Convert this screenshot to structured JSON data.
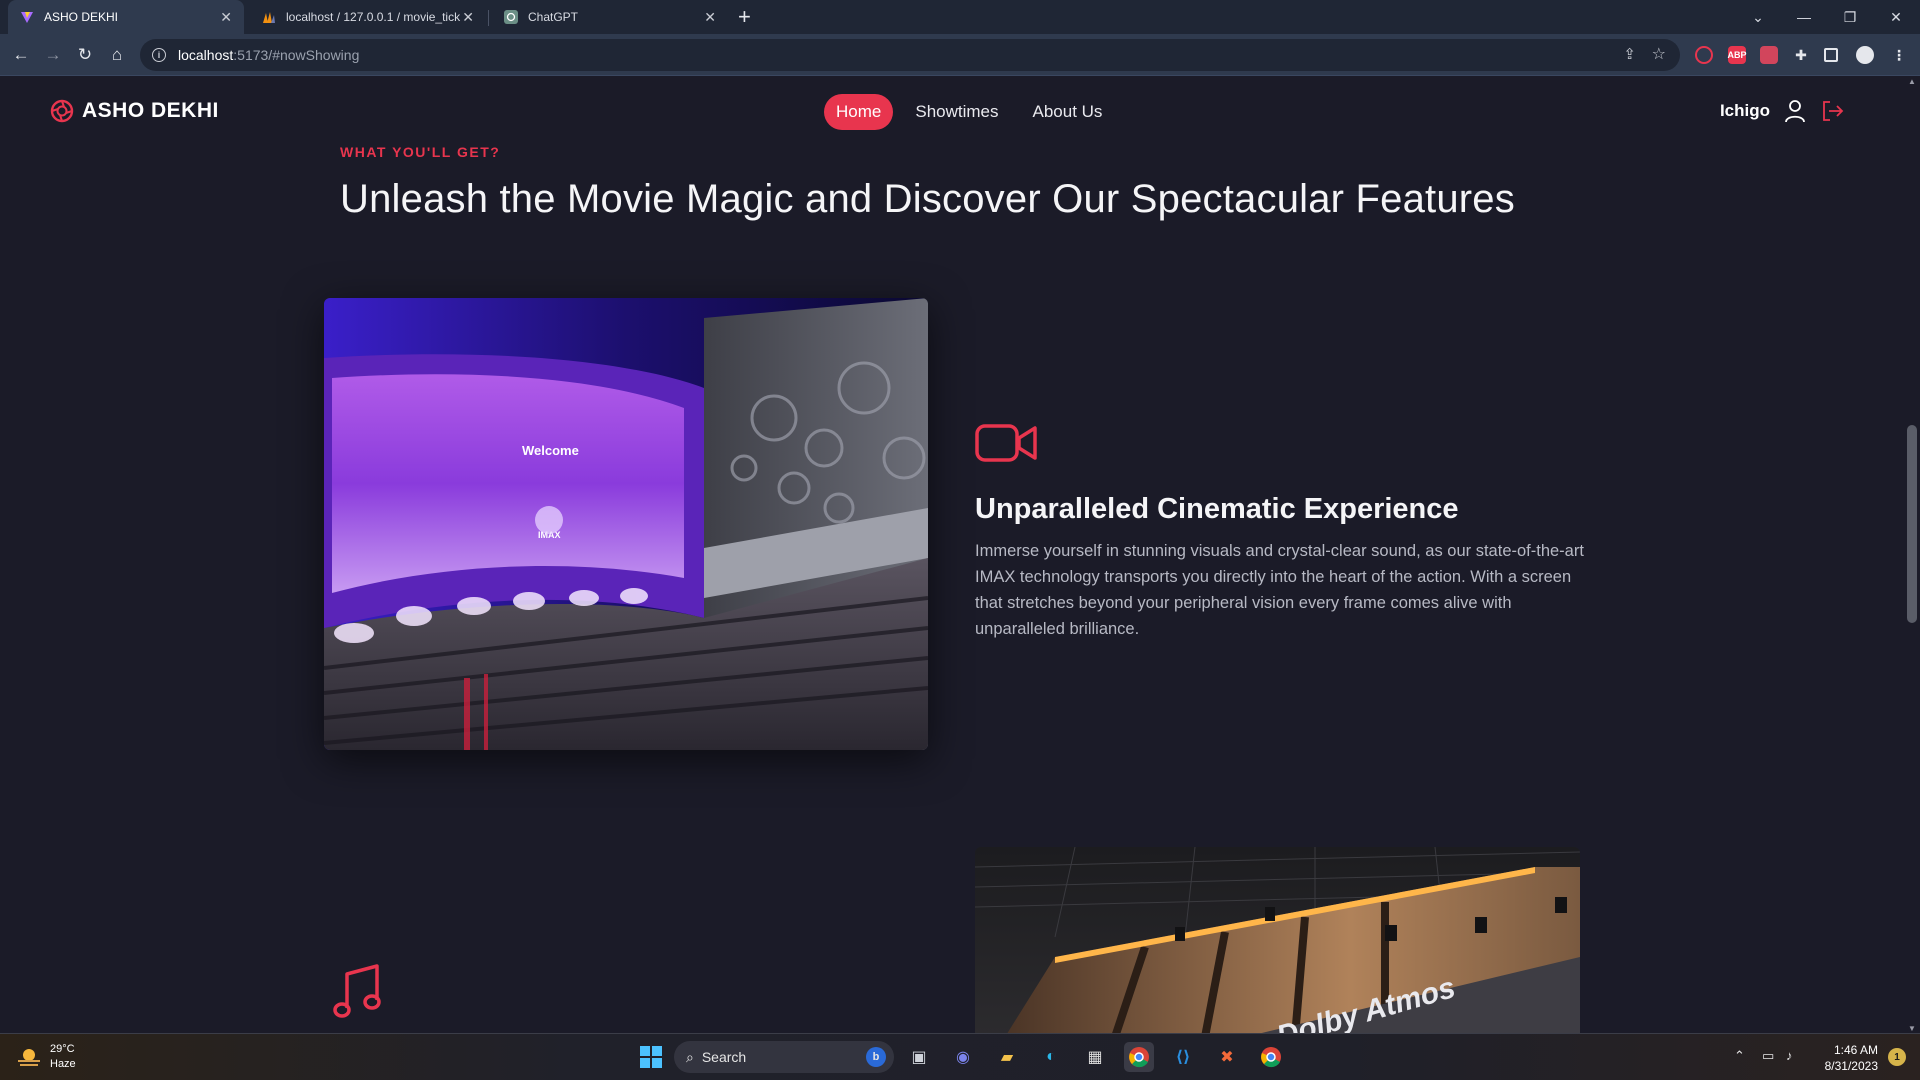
{
  "browser": {
    "tabs": [
      {
        "title": "ASHO DEKHI",
        "active": true
      },
      {
        "title": "localhost / 127.0.0.1 / movie_tick",
        "active": false
      },
      {
        "title": "ChatGPT",
        "active": false
      }
    ],
    "url_host": "localhost",
    "url_path": ":5173/#nowShowing",
    "extensions": [
      "ABP"
    ]
  },
  "site": {
    "brand": "ASHO DEKHI",
    "menu": [
      {
        "label": "Home",
        "active": true
      },
      {
        "label": "Showtimes",
        "active": false
      },
      {
        "label": "About Us",
        "active": false
      }
    ],
    "username": "Ichigo"
  },
  "section": {
    "eyebrow": "WHAT YOU'LL GET?",
    "headline": "Unleash the Movie Magic and Discover Our Spectacular Features"
  },
  "features": [
    {
      "icon": "video-camera-icon",
      "title": "Unparalleled Cinematic Experience",
      "description": "Immerse yourself in stunning visuals and crystal-clear sound, as our state-of-the-art IMAX technology transports you directly into the heart of the action. With a screen that stretches beyond your peripheral vision every frame comes alive with unparalleled brilliance.",
      "image_text": [
        "Welcome",
        "IMAX"
      ]
    },
    {
      "icon": "music-note-icon",
      "image_text": "Dolby Atmos"
    }
  ],
  "taskbar": {
    "temperature": "29°C",
    "condition": "Haze",
    "search_placeholder": "Search",
    "time": "1:46 AM",
    "date": "8/31/2023",
    "notification_count": "1"
  },
  "colors": {
    "accent": "#e8354e",
    "page_bg": "#1b1b28"
  }
}
